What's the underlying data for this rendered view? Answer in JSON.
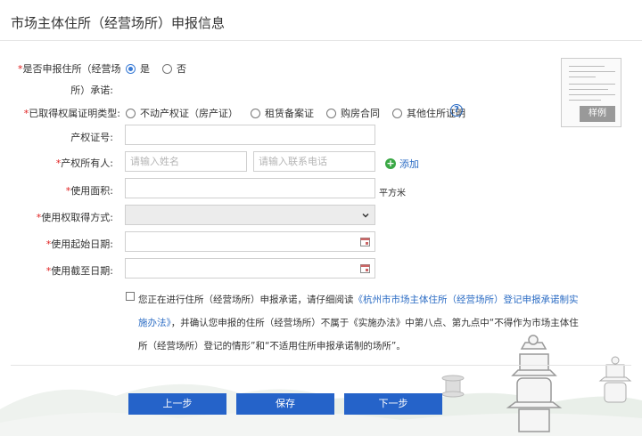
{
  "page": {
    "title": "市场主体住所（经营场所）申报信息"
  },
  "form": {
    "pledge_question": {
      "label_line1": "是否申报住所（经营场",
      "label_line2": "所）承诺:",
      "options": [
        "是",
        "否"
      ],
      "selected": "是"
    },
    "proof_type": {
      "label": "已取得权属证明类型:",
      "options": [
        "不动产权证（房产证）",
        "租赁备案证",
        "购房合同",
        "其他住所证明"
      ],
      "help_icon": "question-circle-icon"
    },
    "cert_no": {
      "label": "产权证号:",
      "value": ""
    },
    "owner": {
      "label": "产权所有人:",
      "name_placeholder": "请输入姓名",
      "phone_placeholder": "请输入联系电话",
      "add_label": "添加"
    },
    "area": {
      "label": "使用面积:",
      "value": "",
      "unit": "平方米"
    },
    "use_right": {
      "label": "使用权取得方式:",
      "value": ""
    },
    "start_date": {
      "label": "使用起始日期:",
      "value": ""
    },
    "end_date": {
      "label": "使用截至日期:",
      "value": ""
    }
  },
  "sample": {
    "stamp": "样例"
  },
  "pledge_text": {
    "part1": "您正在进行住所（经营场所）申报承诺，请仔细阅读",
    "link": "《杭州市市场主体住所（经营场所）登记申报承诺制实施办法》",
    "part2": "，并确认您申报的住所（经营场所）不属于《实施办法》中第八点、第九点中“不得作为市场主体住所（经营场所）登记的情形”和“不适用住所申报承诺制的场所”。"
  },
  "buttons": {
    "prev": "上一步",
    "save": "保存",
    "next": "下一步"
  },
  "colors": {
    "primary": "#2563c9",
    "required": "#e02020",
    "link": "#2b6cc4",
    "add": "#3aa845"
  }
}
